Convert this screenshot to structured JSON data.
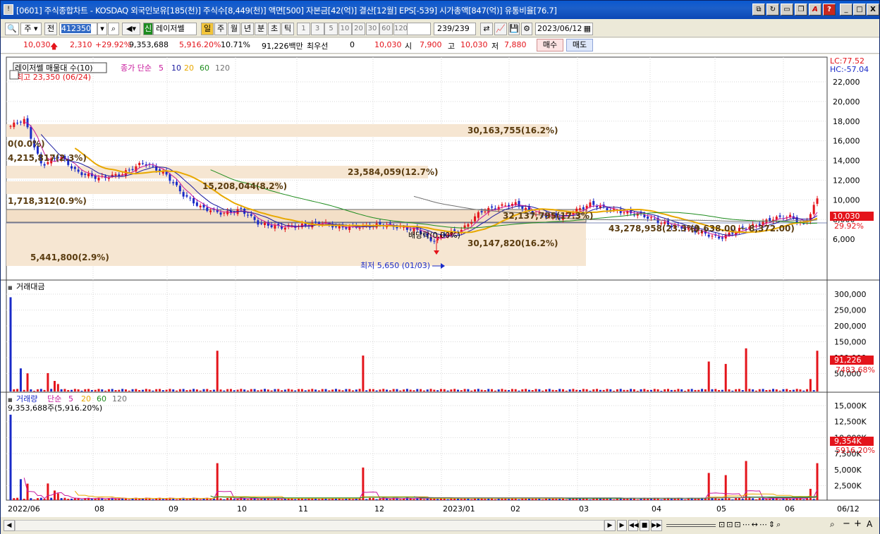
{
  "titlebar": {
    "icon_text": "!",
    "title": "[0601] 주식종합차트 - KOSDAQ 외국인보유[185(천)] 주식수[8,449(천)] 액면[500] 자본금[42(억)] 결산[12월] EPS[-539] 시가총액[847(억)] 유통비율[76.7]",
    "btn_min": "_",
    "btn_max": "□",
    "btn_close": "X",
    "btn_help": "?",
    "btn_a": "A"
  },
  "toolbar": {
    "type_sel": "주",
    "prev": "전",
    "code": "412350",
    "name": "레이저쎌",
    "shin": "신",
    "periods": [
      "일",
      "주",
      "월",
      "년",
      "분",
      "초",
      "틱"
    ],
    "intervals": [
      "1",
      "3",
      "5",
      "10",
      "20",
      "30",
      "60",
      "120"
    ],
    "count": "239",
    "count_total": "/239",
    "date": "2023/06/12"
  },
  "quote": {
    "price": "10,030",
    "change": "2,310",
    "pct": "+29.92%",
    "volume": "9,353,688",
    "vol_pct": "5,916.20%",
    "rate": "10.71%",
    "amount": "91,226백만",
    "bid_label": "최우선",
    "bid": "0",
    "ask": "10,030",
    "open_label": "시",
    "open": "7,900",
    "high_label": "고",
    "high": "10,030",
    "low_label": "저",
    "low": "7,880",
    "buy": "매수",
    "sell": "매도"
  },
  "price_panel": {
    "legend_main": "레이저쎌 매물대 수(10)",
    "legend_ma": "종가 단순",
    "ma_periods": [
      "5",
      "10",
      "20",
      "60",
      "120"
    ],
    "max_label": "최고 23,350 (06/24)",
    "min_label": "최저 5,650 (01/03)",
    "dividend": "배당락(0.00%)",
    "lc": "LC:77.52",
    "hc": "HC:-57.04",
    "cur_price": "10,030",
    "cur_pct": "29.92%",
    "yticks": [
      "22,000",
      "20,000",
      "18,000",
      "16,000",
      "14,000",
      "12,000",
      "10,000",
      "8,000",
      "6,000"
    ],
    "profile": [
      "30,163,755(16.2%)",
      "0(0.0%)",
      "4,215,817(2.3%)",
      "23,584,059(12.7%)",
      "15,208,044(8.2%)",
      "1,718,312(0.9%)",
      "32,137,795(17.3%)",
      "43,278,958(23.3%)",
      "30,147,820(16.2%)",
      "5,441,800(2.9%)"
    ],
    "range_label": "(9,638.00 ~ 8,372.00)"
  },
  "amount_panel": {
    "legend": "거래대금",
    "yticks": [
      "300,000",
      "250,000",
      "200,000",
      "150,000",
      "100,000",
      "50,000"
    ],
    "cur": "91,226",
    "cur_pct": "7483.68%"
  },
  "volume_panel": {
    "legend": "거래량",
    "legend_ma": "단순",
    "ma_periods": [
      "5",
      "20",
      "60",
      "120"
    ],
    "sub": "9,353,688주(5,916.20%)",
    "yticks": [
      "15,000K",
      "12,500K",
      "10,000K",
      "7,500K",
      "5,000K",
      "2,500K"
    ],
    "cur": "9,354K",
    "cur_pct": "5916.20%"
  },
  "xaxis": [
    "2022/06",
    "08",
    "09",
    "10",
    "11",
    "12",
    "2023/01",
    "02",
    "03",
    "04",
    "05",
    "06"
  ],
  "xaxis_right": "06/12",
  "colors": {
    "up": "#e4141b",
    "down": "#1a2bc8",
    "ma5": "#c8189c",
    "ma10": "#1a1aa0",
    "ma20": "#e8a800",
    "ma60": "#1e8c1e",
    "ma120": "#707070",
    "profile": "#f6e6d2"
  }
}
